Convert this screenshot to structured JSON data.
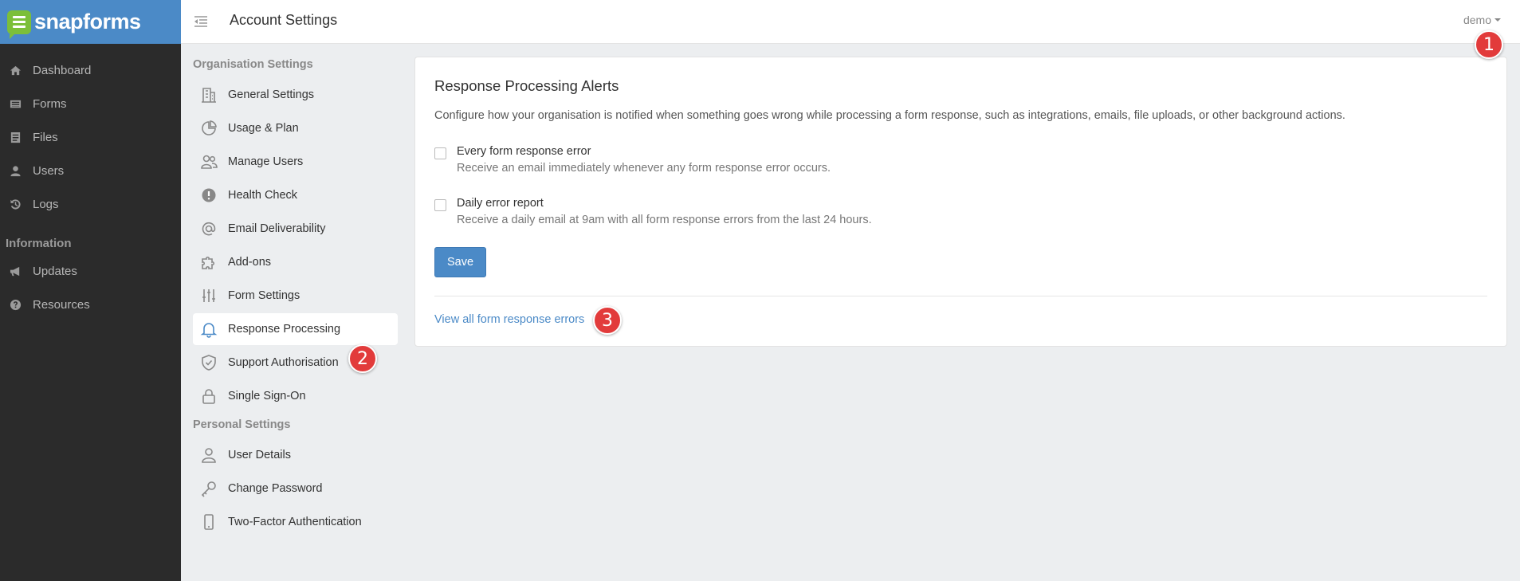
{
  "brand": {
    "name": "snapforms",
    "logo_color": "#7cbf3a",
    "bar_color": "#4b8ac7"
  },
  "nav": {
    "items": [
      {
        "label": "Dashboard",
        "icon": "home-icon"
      },
      {
        "label": "Forms",
        "icon": "list-icon"
      },
      {
        "label": "Files",
        "icon": "file-icon"
      },
      {
        "label": "Users",
        "icon": "user-icon"
      },
      {
        "label": "Logs",
        "icon": "history-icon"
      }
    ],
    "section_info": "Information",
    "info_items": [
      {
        "label": "Updates",
        "icon": "megaphone-icon"
      },
      {
        "label": "Resources",
        "icon": "question-circle-icon"
      }
    ]
  },
  "header": {
    "title": "Account Settings",
    "user": "demo"
  },
  "settings_menu": {
    "org_section": "Organisation Settings",
    "org_items": [
      {
        "label": "General Settings",
        "icon": "building-icon"
      },
      {
        "label": "Usage & Plan",
        "icon": "pie-chart-icon"
      },
      {
        "label": "Manage Users",
        "icon": "users-icon"
      },
      {
        "label": "Health Check",
        "icon": "alert-circle-icon"
      },
      {
        "label": "Email Deliverability",
        "icon": "at-sign-icon"
      },
      {
        "label": "Add-ons",
        "icon": "puzzle-icon"
      },
      {
        "label": "Form Settings",
        "icon": "sliders-icon"
      },
      {
        "label": "Response Processing",
        "icon": "bell-icon",
        "active": true
      },
      {
        "label": "Support Authorisation",
        "icon": "shield-check-icon"
      },
      {
        "label": "Single Sign-On",
        "icon": "lock-icon"
      }
    ],
    "personal_section": "Personal Settings",
    "personal_items": [
      {
        "label": "User Details",
        "icon": "person-icon"
      },
      {
        "label": "Change Password",
        "icon": "key-icon"
      },
      {
        "label": "Two-Factor Authentication",
        "icon": "phone-icon"
      }
    ]
  },
  "card": {
    "title": "Response Processing Alerts",
    "description": "Configure how your organisation is notified when something goes wrong while processing a form response, such as integrations, emails, file uploads, or other background actions.",
    "options": [
      {
        "label": "Every form response error",
        "help": "Receive an email immediately whenever any form response error occurs.",
        "checked": false
      },
      {
        "label": "Daily error report",
        "help": "Receive a daily email at 9am with all form response errors from the last 24 hours.",
        "checked": false
      }
    ],
    "save_label": "Save",
    "view_link": "View all form response errors"
  },
  "markers": [
    "1",
    "2",
    "3"
  ],
  "colors": {
    "accent": "#4b8ac7",
    "marker": "#e23b3b",
    "sidebar": "#2b2b2b"
  }
}
